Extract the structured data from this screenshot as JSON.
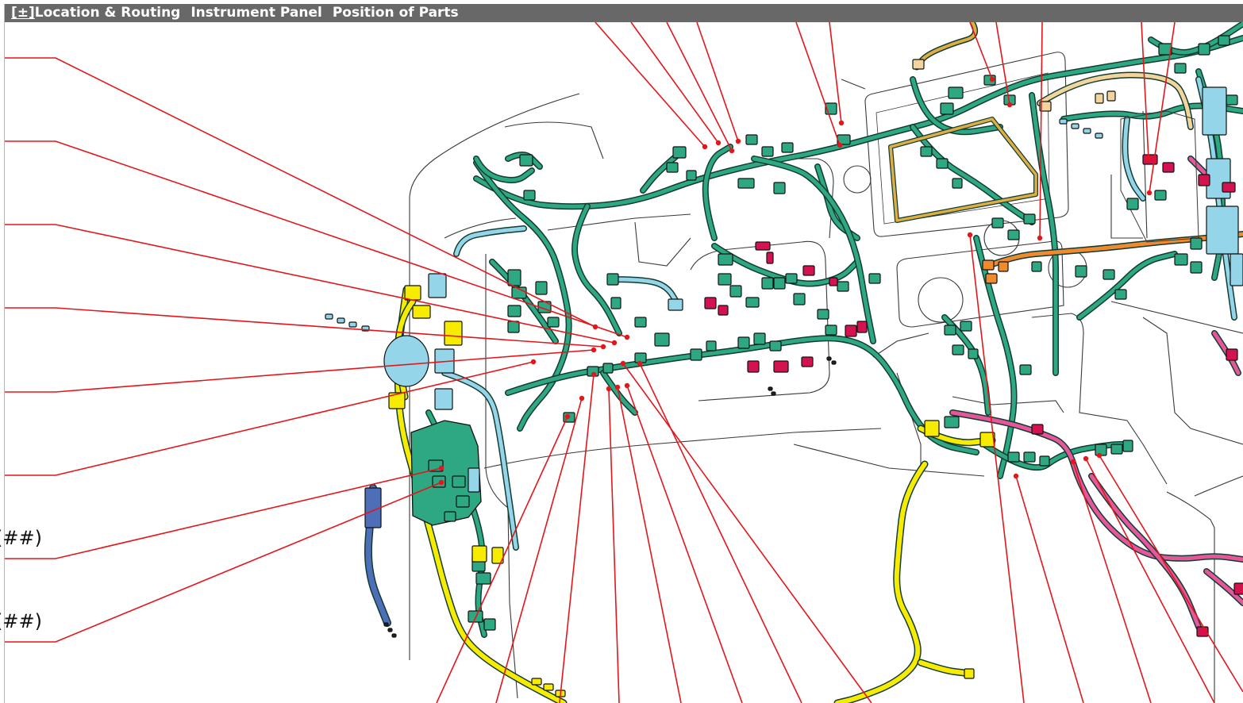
{
  "title_bar": {
    "toggle": "[±]",
    "sections": [
      "Location & Routing",
      "Instrument Panel",
      "Position of Parts"
    ]
  },
  "labels": {
    "callout_1": "(##)",
    "callout_2": "(##)"
  },
  "icons": {
    "toggle": "expand-collapse-icon"
  },
  "colors": {
    "title_bg": "#686868",
    "title_text": "#ffffff",
    "leader_line": "#e3161b",
    "harness_main": "#2ea882",
    "harness_outline": "#123c31",
    "harness_yellow": "#f7ec00",
    "harness_light_blue": "#94d5ea",
    "harness_dark_blue": "#4c6fb8",
    "harness_pink": "#e6569b",
    "harness_orange": "#ef8a2e",
    "harness_gold": "#dcae44",
    "harness_tan": "#f2d59c",
    "connector_red": "#d3124f",
    "panel_outline": "#3a3a3a"
  }
}
